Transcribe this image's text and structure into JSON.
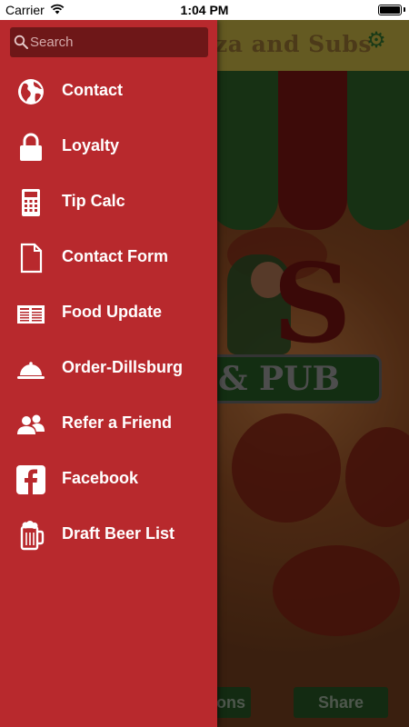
{
  "status_bar": {
    "carrier": "Carrier",
    "time": "1:04 PM"
  },
  "search": {
    "placeholder": "Search"
  },
  "menu": {
    "items": [
      {
        "label": "Contact",
        "icon": "globe-icon"
      },
      {
        "label": "Loyalty",
        "icon": "lock-icon"
      },
      {
        "label": "Tip Calc",
        "icon": "calculator-icon"
      },
      {
        "label": "Contact Form",
        "icon": "document-icon"
      },
      {
        "label": "Food Update",
        "icon": "newspaper-icon"
      },
      {
        "label": "Order-Dillsburg",
        "icon": "food-tray-icon"
      },
      {
        "label": "Refer a Friend",
        "icon": "people-icon"
      },
      {
        "label": "Facebook",
        "icon": "facebook-icon"
      },
      {
        "label": "Draft Beer List",
        "icon": "beer-mug-icon"
      }
    ]
  },
  "background": {
    "title_partial": "za and Subs",
    "logo_partial": "& PUB",
    "left_button_partial": "ons",
    "share_button": "Share"
  },
  "colors": {
    "drawer": "#b8292d",
    "search_field": "#6e1718",
    "menu_text": "#ffffff"
  }
}
